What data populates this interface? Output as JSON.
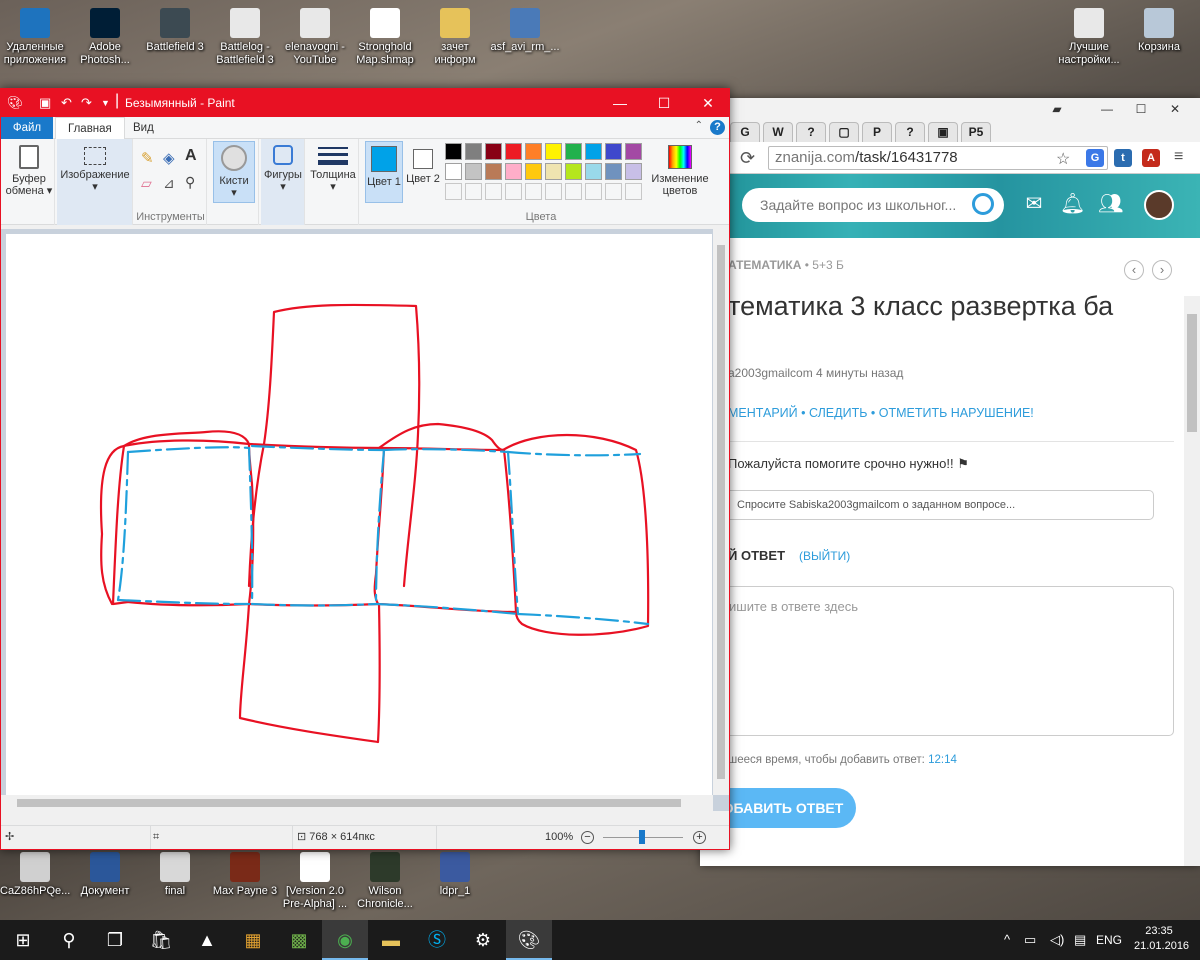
{
  "desktop": {
    "icons_top": [
      {
        "label": "Удаленные приложения",
        "color": "#1e73be"
      },
      {
        "label": "Adobe Photosh...",
        "color": "#001e36"
      },
      {
        "label": "Battlefield 3",
        "color": "#3c4a52"
      },
      {
        "label": "Battlelog - Battlefield 3",
        "color": "#e8e8e8"
      },
      {
        "label": "elenavogni - YouTube",
        "color": "#e8e8e8"
      },
      {
        "label": "Stronghold Map.shmap",
        "color": "#ffffff"
      },
      {
        "label": "зачет информ",
        "color": "#e6c25a"
      },
      {
        "label": "asf_avi_rm_...",
        "color": "#4a7ab8"
      }
    ],
    "icons_right": [
      {
        "label": "Лучшие настройки...",
        "color": "#e8e8e8"
      },
      {
        "label": "Корзина",
        "color": "#b8c8d8"
      }
    ],
    "icons_bottom": [
      {
        "label": "CaZ86hPQe...",
        "color": "#d0d0d0"
      },
      {
        "label": "Документ",
        "color": "#2b579a"
      },
      {
        "label": "final",
        "color": "#d8d8d8"
      },
      {
        "label": "Max Payne 3",
        "color": "#7a2a18"
      },
      {
        "label": "[Version 2.0 Pre-Alpha] ...",
        "color": "#ffffff"
      },
      {
        "label": "Wilson Chronicle...",
        "color": "#2d3a2a"
      },
      {
        "label": "ldpr_1",
        "color": "#3b5aa0"
      }
    ]
  },
  "chrome": {
    "url_scheme": "znanija.com",
    "url_path": "/task/16431778",
    "tabs": [
      "G",
      "W",
      "?",
      "▢",
      "P",
      "?",
      "▣",
      "P5"
    ],
    "search_placeholder": "Задайте вопрос из школьног...",
    "category": "АТЕМАТИКА",
    "points": "• 5+3 Б",
    "title": "тематика 3 класс развертка ба",
    "author": "a2003gmailcom 4 минуты назад",
    "actions": "МЕНТАРИЙ • СЛЕДИТЬ • ОТМЕТИТЬ НАРУШЕНИЕ!",
    "question_body": "Пожалуйста помогите срочно нужно!!",
    "ask_placeholder": "Спросите Sabiska2003gmailcom о заданном вопросе...",
    "answer_label": "Й ОТВЕТ",
    "exit_label": "(ВЫЙТИ)",
    "answer_placeholder": "ишите в ответе здесь",
    "time_left_label": "шееся время, чтобы добавить ответ:",
    "time_left_value": "12:14",
    "add_answer_button": "ОБАВИТЬ ОТВЕТ"
  },
  "paint": {
    "title": "Безымянный - Paint",
    "menu": {
      "file": "Файл",
      "home": "Главная",
      "view": "Вид"
    },
    "ribbon": {
      "clipboard": "Буфер обмена",
      "image": "Изображение",
      "tools": "Инструменты",
      "brushes": "Кисти",
      "shapes": "Фигуры",
      "size": "Толщина",
      "color1": "Цвет 1",
      "color2": "Цвет 2",
      "colors_group": "Цвета",
      "edit_colors": "Изменение цветов"
    },
    "palette_row1": [
      "#000000",
      "#7f7f7f",
      "#880015",
      "#ed1c24",
      "#ff7f27",
      "#fff200",
      "#22b14c",
      "#00a2e8",
      "#3f48cc",
      "#a349a4"
    ],
    "palette_row2": [
      "#ffffff",
      "#c3c3c3",
      "#b97a57",
      "#ffaec9",
      "#ffc90e",
      "#efe4b0",
      "#b5e61d",
      "#99d9ea",
      "#7092be",
      "#c8bfe7"
    ],
    "color1_value": "#00a2e8",
    "color2_value": "#ffffff",
    "status": {
      "dimensions": "768 × 614пкс",
      "zoom": "100%"
    },
    "canvas": {
      "stroke_red": "#e81123",
      "stroke_blue": "#1fa0dc"
    }
  },
  "taskbar": {
    "lang": "ENG",
    "time": "23:35",
    "date": "21.01.2016"
  }
}
